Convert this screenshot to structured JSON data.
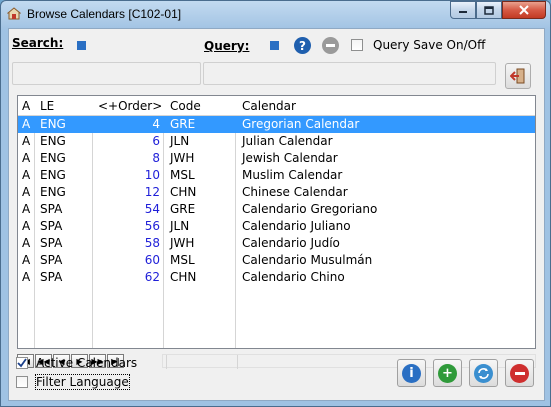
{
  "window": {
    "title": "Browse Calendars [C102-01]"
  },
  "toolbar": {
    "search_label": "Search:",
    "query_label": "Query:",
    "help_icon": "?",
    "query_save_label": "Query Save On/Off"
  },
  "grid": {
    "columns": [
      "A",
      "LE",
      "<+Order>",
      "Code",
      "Calendar"
    ],
    "rows": [
      {
        "a": "A",
        "le": "ENG",
        "order": "4",
        "code": "GRE",
        "calendar": "Gregorian Calendar",
        "selected": true
      },
      {
        "a": "A",
        "le": "ENG",
        "order": "6",
        "code": "JLN",
        "calendar": "Julian Calendar"
      },
      {
        "a": "A",
        "le": "ENG",
        "order": "8",
        "code": "JWH",
        "calendar": "Jewish Calendar"
      },
      {
        "a": "A",
        "le": "ENG",
        "order": "10",
        "code": "MSL",
        "calendar": "Muslim Calendar"
      },
      {
        "a": "A",
        "le": "ENG",
        "order": "12",
        "code": "CHN",
        "calendar": "Chinese Calendar"
      },
      {
        "a": "A",
        "le": "SPA",
        "order": "54",
        "code": "GRE",
        "calendar": "Calendario Gregoriano"
      },
      {
        "a": "A",
        "le": "SPA",
        "order": "56",
        "code": "JLN",
        "calendar": "Calendario Juliano"
      },
      {
        "a": "A",
        "le": "SPA",
        "order": "58",
        "code": "JWH",
        "calendar": "Calendario Judío"
      },
      {
        "a": "A",
        "le": "SPA",
        "order": "60",
        "code": "MSL",
        "calendar": "Calendario Musulmán"
      },
      {
        "a": "A",
        "le": "SPA",
        "order": "62",
        "code": "CHN",
        "calendar": "Calendario Chino"
      }
    ]
  },
  "options": {
    "active_calendars": "Active Calendars",
    "filter_language": "Filter Language"
  },
  "colors": {
    "selection": "#3399ff",
    "order_text": "#1f1fd8",
    "accent": "#2a6fc3"
  }
}
